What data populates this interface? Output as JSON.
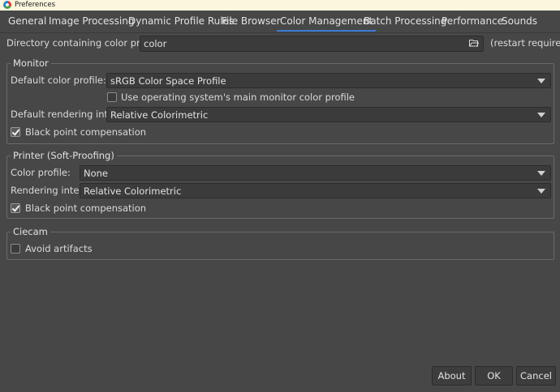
{
  "window": {
    "title": "Preferences"
  },
  "tabs": [
    {
      "label": "General"
    },
    {
      "label": "Image Processing"
    },
    {
      "label": "Dynamic Profile Rules"
    },
    {
      "label": "File Browser"
    },
    {
      "label": "Color Management"
    },
    {
      "label": "Batch Processing"
    },
    {
      "label": "Performance"
    },
    {
      "label": "Sounds"
    }
  ],
  "active_tab": "Color Management",
  "directory": {
    "label": "Directory containing color profiles:",
    "value": "color",
    "note": "(restart required)"
  },
  "monitor": {
    "title": "Monitor",
    "profile_label": "Default color profile:",
    "profile_value": "sRGB Color Space Profile",
    "use_os_label": "Use operating system's main monitor color profile",
    "use_os_checked": false,
    "intent_label": "Default rendering intent:",
    "intent_value": "Relative Colorimetric",
    "bpc_label": "Black point compensation",
    "bpc_checked": true
  },
  "printer": {
    "title": "Printer (Soft-Proofing)",
    "profile_label": "Color profile:",
    "profile_value": "None",
    "intent_label": "Rendering intent:",
    "intent_value": "Relative Colorimetric",
    "bpc_label": "Black point compensation",
    "bpc_checked": true
  },
  "ciecam": {
    "title": "Ciecam",
    "avoid_label": "Avoid artifacts",
    "avoid_checked": false
  },
  "buttons": {
    "about": "About",
    "ok": "OK",
    "cancel": "Cancel"
  },
  "colors": {
    "background": "#474747",
    "accent": "#3a7bd5",
    "titlebar": "#fbf6dd"
  }
}
